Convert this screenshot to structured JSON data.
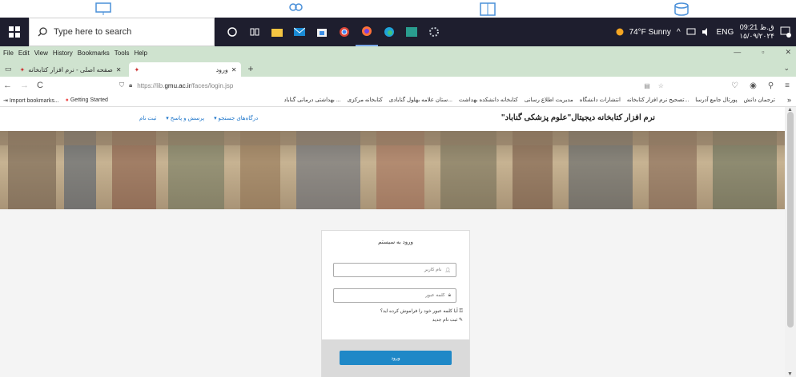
{
  "taskbar": {
    "search_placeholder": "Type here to search",
    "weather": "74°F  Sunny",
    "lang": "ENG",
    "clock_line1": "09:21 ق.ظ",
    "clock_line2": "۱۵/۰۹/۲۰۲۴",
    "notification_count": "1"
  },
  "browser": {
    "menu": [
      "File",
      "Edit",
      "View",
      "History",
      "Bookmarks",
      "Tools",
      "Help"
    ],
    "tabs": [
      {
        "label": "صفحه اصلی - نرم افزار کتابخانه"
      },
      {
        "label": "ورود"
      }
    ],
    "url_prefix": "https://lib.",
    "url_host": "gmu.ac.ir",
    "url_path": "/faces/login.jsp",
    "bookmarks_left": [
      "Import bookmarks...",
      "Getting Started"
    ],
    "bookmarks_rtl": [
      "ترجمان دانش",
      "پورتال جامع آدرسا",
      "...تصحیح نرم افزار کتابخانه",
      "انتشارات دانشگاه",
      "مدیریت اطلاع رسانی",
      "کتابخانه دانشکده بهداشت",
      "...ستان علامه بهلول گنابادی",
      "کتابخانه مرکزی",
      "... بهداشتی درمانی گناباد"
    ]
  },
  "site": {
    "title": "نرم افزار کتابخانه دیجیتال\"علوم پزشکی گناباد\"",
    "nav": [
      "درگاه‌های جستجو ▾",
      "پرسش و پاسخ ▾",
      "ثبت نام"
    ]
  },
  "login": {
    "title": "ورود به سیستم",
    "username_placeholder": "نام کاربر",
    "password_placeholder": "کلمه عبور",
    "forgot_link": "آیا کلمه عبور خود را فراموش کرده اید؟",
    "register_link": "ثبت نام جدید",
    "submit_label": "ورود"
  }
}
